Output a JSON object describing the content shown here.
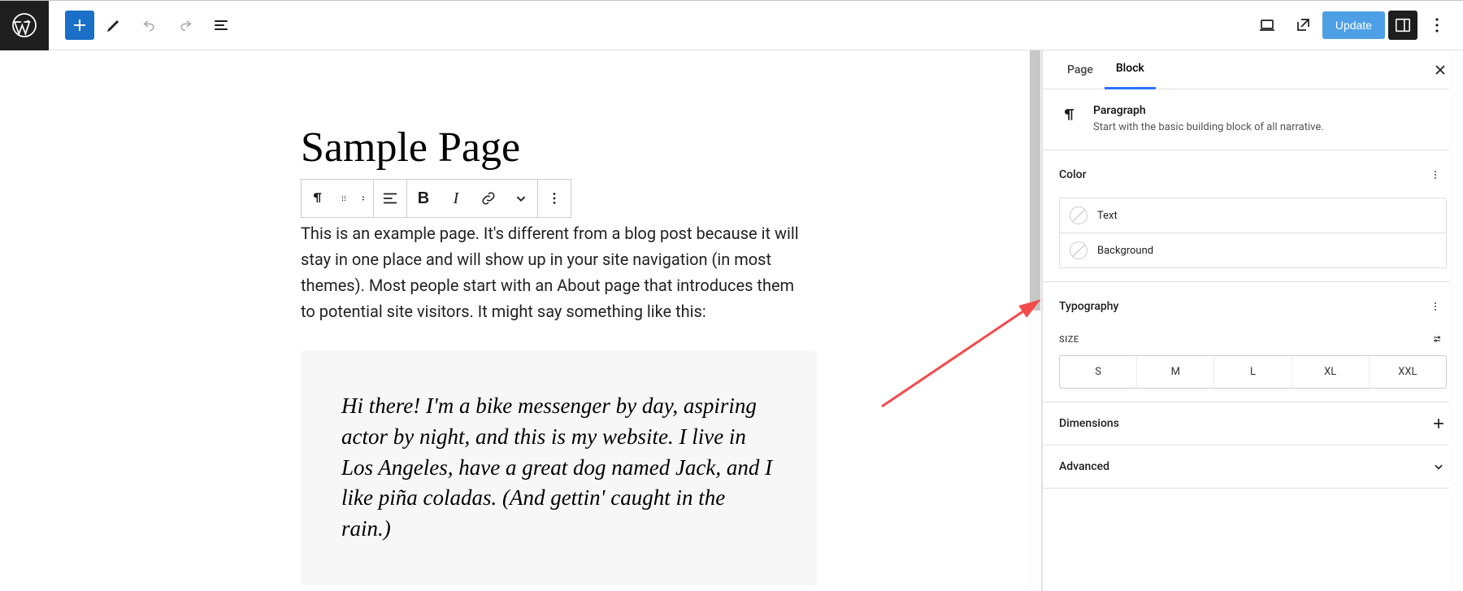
{
  "topbar": {
    "update_label": "Update"
  },
  "editor": {
    "title": "Sample Page",
    "paragraph": "This is an example page. It's different from a blog post because it will stay in one place and will show up in your site navigation (in most themes). Most people start with an About page that introduces them to potential site visitors. It might say something like this:",
    "quote": "Hi there! I'm a bike messenger by day, aspiring actor by night, and this is my website. I live in Los Angeles, have a great dog named Jack, and I like piña coladas. (And gettin' caught in the rain.)"
  },
  "sidebar": {
    "tabs": {
      "page": "Page",
      "block": "Block"
    },
    "block": {
      "title": "Paragraph",
      "description": "Start with the basic building block of all narrative."
    },
    "panels": {
      "color": {
        "title": "Color",
        "text_label": "Text",
        "background_label": "Background"
      },
      "typography": {
        "title": "Typography",
        "size_label": "SIZE",
        "sizes": [
          "S",
          "M",
          "L",
          "XL",
          "XXL"
        ]
      },
      "dimensions": {
        "title": "Dimensions"
      },
      "advanced": {
        "title": "Advanced"
      }
    }
  }
}
